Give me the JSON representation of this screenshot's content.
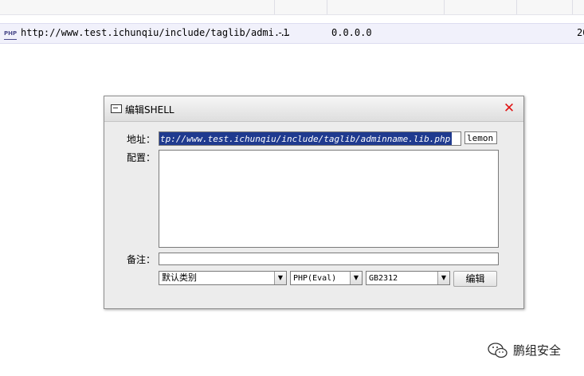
{
  "list": {
    "rows": [
      {
        "icon": "PHP",
        "url": "http://www.test.ichunqiu/include/taglib/admi...",
        "status": "-1",
        "ip": "0.0.0.0",
        "date": "20"
      }
    ]
  },
  "dialog": {
    "title": "编辑SHELL",
    "address_label": "地址：",
    "address_value": "tp://www.test.ichunqiu/include/taglib/adminname.lib.php",
    "password_value": "lemon",
    "config_label": "配置：",
    "config_value": "",
    "note_label": "备注：",
    "note_value": "",
    "category_select": "默认类别",
    "script_type_select": "PHP(Eval)",
    "encoding_select": "GB2312",
    "edit_button": "编辑"
  },
  "watermark": {
    "text": "鹏组安全"
  },
  "icons": {
    "row_icon": "php-file-icon",
    "title_icon": "window-icon",
    "close_icon": "close-icon",
    "dropdown_icon": "chevron-down-icon",
    "watermark_icon": "wechat-icon"
  },
  "colors": {
    "selection": "#1f3a8f",
    "close": "#e01414",
    "row_highlight": "#f1f1fb",
    "dialog_bg": "#ececec"
  }
}
